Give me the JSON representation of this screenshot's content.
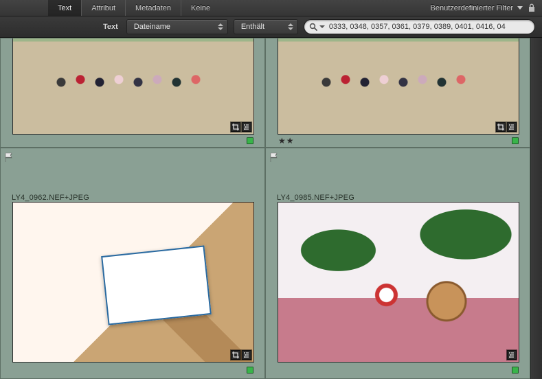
{
  "filterTabs": {
    "items": [
      {
        "label": "Text",
        "active": true
      },
      {
        "label": "Attribut",
        "active": false
      },
      {
        "label": "Metadaten",
        "active": false
      },
      {
        "label": "Keine",
        "active": false
      }
    ],
    "presetLabel": "Benutzerdefinierter Filter"
  },
  "searchRow": {
    "label": "Text",
    "fieldCombo": "Dateiname",
    "modeCombo": "Enthält",
    "query": "0333, 0348, 0357, 0361, 0379, 0389, 0401, 0416, 04"
  },
  "grid": {
    "cells": [
      {
        "filename": "",
        "rating": 0,
        "greenLabel": true,
        "badges": [
          "crop",
          "adjust"
        ]
      },
      {
        "filename": "",
        "rating": 2,
        "greenLabel": true,
        "badges": [
          "crop",
          "adjust"
        ]
      },
      {
        "filename": "LY4_0962.NEF+JPEG",
        "rating": 0,
        "greenLabel": true,
        "badges": [
          "crop",
          "adjust"
        ]
      },
      {
        "filename": "LY4_0985.NEF+JPEG",
        "rating": 0,
        "greenLabel": true,
        "badges": [
          "adjust"
        ]
      }
    ],
    "starGlyph": "★"
  },
  "icons": {
    "lock": "lock-icon",
    "search": "search-icon",
    "flag": "flag-icon",
    "crop": "crop-icon",
    "adjust": "adjust-icon",
    "chevron": "chevron-down-icon"
  }
}
